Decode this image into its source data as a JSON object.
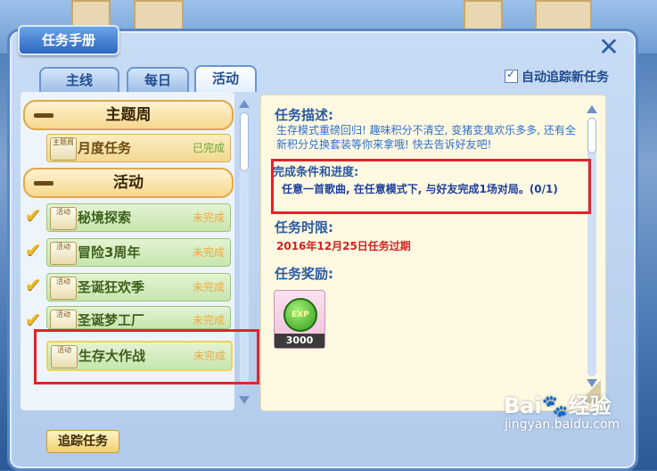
{
  "window": {
    "title": "任务手册"
  },
  "tabs": [
    {
      "label": "主线",
      "active": false
    },
    {
      "label": "每日",
      "active": false
    },
    {
      "label": "活动",
      "active": true
    }
  ],
  "auto_track": {
    "label": "自动追踪新任务",
    "checked": true
  },
  "categories": [
    {
      "label": "主题周"
    },
    {
      "label": "活动"
    }
  ],
  "items": [
    {
      "name": "月度任务",
      "status": "已完成",
      "icon_text": "主题周",
      "done": true,
      "checked": false
    },
    {
      "name": "秘境探索",
      "status": "未完成",
      "icon_text": "活动",
      "done": false,
      "checked": true
    },
    {
      "name": "冒险3周年",
      "status": "未完成",
      "icon_text": "活动",
      "done": false,
      "checked": true
    },
    {
      "name": "圣诞狂欢季",
      "status": "未完成",
      "icon_text": "活动",
      "done": false,
      "checked": true
    },
    {
      "name": "圣诞梦工厂",
      "status": "未完成",
      "icon_text": "活动",
      "done": false,
      "checked": true
    },
    {
      "name": "生存大作战",
      "status": "未完成",
      "icon_text": "活动",
      "done": false,
      "checked": false
    }
  ],
  "detail": {
    "desc_title": "任务描述:",
    "desc_text": "生存模式重磅回归! 趣味积分不清空, 变猪变鬼欢乐多多, 还有全新积分兑换套装等你来拿哦! 快去告诉好友吧!",
    "cond_title": "完成条件和进度:",
    "cond_text": "任意一首歌曲, 在任意模式下, 与好友完成1场对局。(0/1)",
    "deadline_title": "任务时限:",
    "deadline_text": "2016年12月25日任务过期",
    "reward_title": "任务奖励:",
    "reward_badge": "EXP",
    "reward_amount": "3000"
  },
  "track_button": "追踪任务",
  "watermark": {
    "main": "Bai🐾经验",
    "sub": "jingyan.baidu.com"
  },
  "colors": {
    "highlight": "#e0242c",
    "accent": "#2a5aa5",
    "deadline": "#d32020"
  }
}
